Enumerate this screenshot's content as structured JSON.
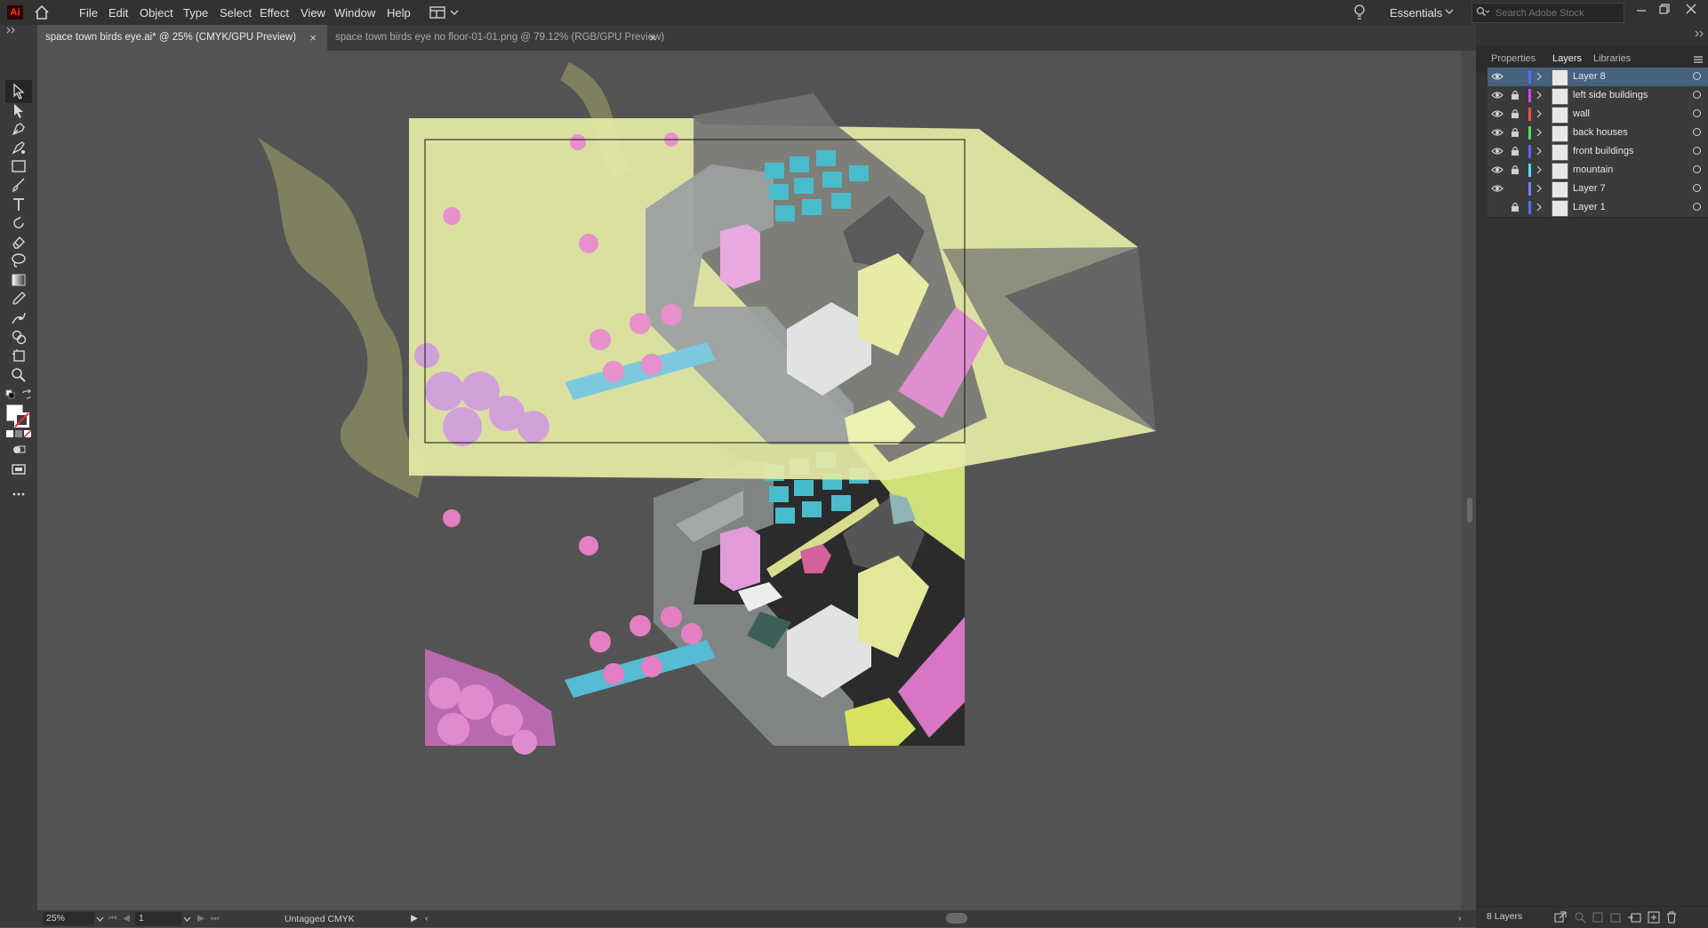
{
  "app": {
    "logo_text": "Ai"
  },
  "menu": [
    "File",
    "Edit",
    "Object",
    "Type",
    "Select",
    "Effect",
    "View",
    "Window",
    "Help"
  ],
  "workspace": {
    "name": "Essentials"
  },
  "search": {
    "placeholder": "Search Adobe Stock"
  },
  "tabs": [
    {
      "title": "space town birds eye.ai* @ 25% (CMYK/GPU Preview)",
      "active": true
    },
    {
      "title": "space town birds eye no floor-01-01.png @ 79.12% (RGB/GPU Preview)",
      "active": false
    }
  ],
  "panel": {
    "tabs": [
      "Properties",
      "Layers",
      "Libraries"
    ],
    "active_tab": "Layers",
    "layers": [
      {
        "name": "Layer 8",
        "color": "#4f6fff",
        "visible": true,
        "locked": false,
        "selected": true
      },
      {
        "name": "left side buildings",
        "color": "#c24bff",
        "visible": true,
        "locked": true,
        "selected": false
      },
      {
        "name": "wall",
        "color": "#ff4f4f",
        "visible": true,
        "locked": true,
        "selected": false
      },
      {
        "name": "back houses",
        "color": "#4fdf4f",
        "visible": true,
        "locked": true,
        "selected": false
      },
      {
        "name": "front buildings",
        "color": "#5f5fff",
        "visible": true,
        "locked": true,
        "selected": false
      },
      {
        "name": "mountain",
        "color": "#4fdfff",
        "visible": true,
        "locked": true,
        "selected": false
      },
      {
        "name": "Layer 7",
        "color": "#7f7fff",
        "visible": true,
        "locked": false,
        "selected": false
      },
      {
        "name": "Layer 1",
        "color": "#4f6fff",
        "visible": false,
        "locked": true,
        "selected": false
      }
    ],
    "layer_count": "8 Layers"
  },
  "status": {
    "zoom": "25%",
    "page": "1",
    "profile": "Untagged CMYK"
  },
  "colors": {
    "accent": "#46627e",
    "canvas_bg": "#535353",
    "chrome": "#323232"
  }
}
